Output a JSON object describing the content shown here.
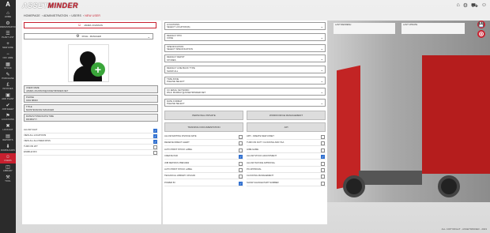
{
  "app": {
    "brand_left": "ASSET",
    "brand_right": "MINDER"
  },
  "sidebar": {
    "logo": "A",
    "items": [
      {
        "label": "HOME",
        "icon": "⌂"
      },
      {
        "label": "ADMINISTRATION",
        "icon": "⚙"
      },
      {
        "label": "PLANT LIST",
        "icon": "☰"
      },
      {
        "label": "NEW HIRE",
        "icon": "+"
      },
      {
        "label": "OFF HIRE",
        "icon": "−"
      },
      {
        "label": "STOCK",
        "icon": "▦"
      },
      {
        "label": "PURCHASE",
        "icon": "✎"
      },
      {
        "label": "INVOICES",
        "icon": "£"
      },
      {
        "label": "ADD PLANT",
        "icon": "▣"
      },
      {
        "label": "JOB SHEET",
        "icon": "✔"
      },
      {
        "label": "LOCATIONS",
        "icon": "⚑"
      },
      {
        "label": "LOCKOUT",
        "icon": "✖"
      },
      {
        "label": "REPORTS",
        "icon": "▤"
      },
      {
        "label": "DOWNLOADS",
        "icon": "⬇"
      },
      {
        "label": "USERS",
        "icon": "☺"
      },
      {
        "label": "LIBRARY",
        "icon": "◫"
      },
      {
        "label": "TOOL",
        "icon": "⚒"
      }
    ]
  },
  "breadcrumb": {
    "home": "HOMEPAGE",
    "admin": "ADMINISTRATION",
    "users": "USERS",
    "current": "NEW USER"
  },
  "left": {
    "name_value": "JAMES JOHNSON",
    "role_value": "ROLE - MANAGER",
    "fields": [
      {
        "title": "USER NAME",
        "value": "JAMES.JOHNSON@ASSETMINDER.NET"
      },
      {
        "title": "PHONE",
        "value": "0162 88000"
      },
      {
        "title": "TITLE",
        "value": "MAINTENANCE MANAGER"
      },
      {
        "title": "DATE/SYSTEM DATE TIME",
        "value": "DD/MM/YY"
      }
    ],
    "checks": [
      {
        "label": "ALLOW CHAT",
        "checked": true
      },
      {
        "label": "VIEW ALL LOCATIONS",
        "checked": true
      },
      {
        "label": "VIEW ALL ALLOWED RFSS",
        "checked": true
      },
      {
        "label": "TURN ON 2FT",
        "checked": false
      },
      {
        "label": "ENABLE NFC",
        "checked": false
      }
    ]
  },
  "mid": {
    "selects": [
      {
        "title": "LOCATIONS",
        "value": "SELECT LOCATION(S)"
      },
      {
        "title": "DEFAULT PPU",
        "value": "CONE"
      },
      {
        "title": "SPECIFICATION",
        "value": "SELECT SPECIFICATION"
      },
      {
        "title": "DEFAULT DEPOT",
        "value": "STORES"
      },
      {
        "title": "DEFAULT LINE BACK TYPE",
        "value": "SHOW ALL"
      },
      {
        "title": "TIME ZONE",
        "value": "PLEASE SELECT"
      },
      {
        "title": "CC EMAIL KEYWORD",
        "value": "PAUL.MURRAY@ASSETMINDER.NET"
      },
      {
        "title": "DATE FORMAT",
        "value": "PLEASE SELECT"
      }
    ],
    "buttons": [
      "PERSONAL PRIVATE",
      "WORKFORCE MANAGEMENT",
      "TRAINING DOCUMENTATION",
      "API"
    ]
  },
  "perms_left": [
    {
      "label": "ALLOW EDITING INVOICE DATE",
      "checked": false
    },
    {
      "label": "RECEIVE DIRECT ALERT",
      "checked": false
    },
    {
      "label": "AUTO PRINT STOCK LABEL",
      "checked": false
    },
    {
      "label": "CREATE PAR",
      "checked": true
    },
    {
      "label": "JOB METRICS PREVIEW",
      "checked": false
    },
    {
      "label": "AUTO PRINT STOCK LABEL",
      "checked": false
    },
    {
      "label": "TECHNICAL LIBRARY UPLOAD",
      "checked": false
    },
    {
      "label": "POWER BI",
      "checked": true
    }
  ],
  "perms_right": [
    {
      "label": "APP - CREATE NEW ASSET",
      "checked": false
    },
    {
      "label": "TURN ON DUTY CLOCKING AND T&A",
      "checked": false
    },
    {
      "label": "HIRE GAME",
      "checked": false
    },
    {
      "label": "ALLOW STOCK ADJUSTMENT",
      "checked": true
    },
    {
      "label": "ALLOW INVOICE APPROVAL",
      "checked": false
    },
    {
      "label": "PO APPROVAL",
      "checked": false
    },
    {
      "label": "CLOCKING MANAGEMENT",
      "checked": false
    },
    {
      "label": "SHOW CHANGE PART NUMBER",
      "checked": false
    }
  ],
  "right": {
    "last_refresh_label": "LAST REFRESH",
    "update_label": "LAST UPDATE"
  },
  "footer": "ALL COPYRIGHT - ASSETMINDER - 2023",
  "colors": {
    "accent": "#c8202f",
    "sidebar": "#2b2b2b",
    "check": "#2f6fd0"
  }
}
